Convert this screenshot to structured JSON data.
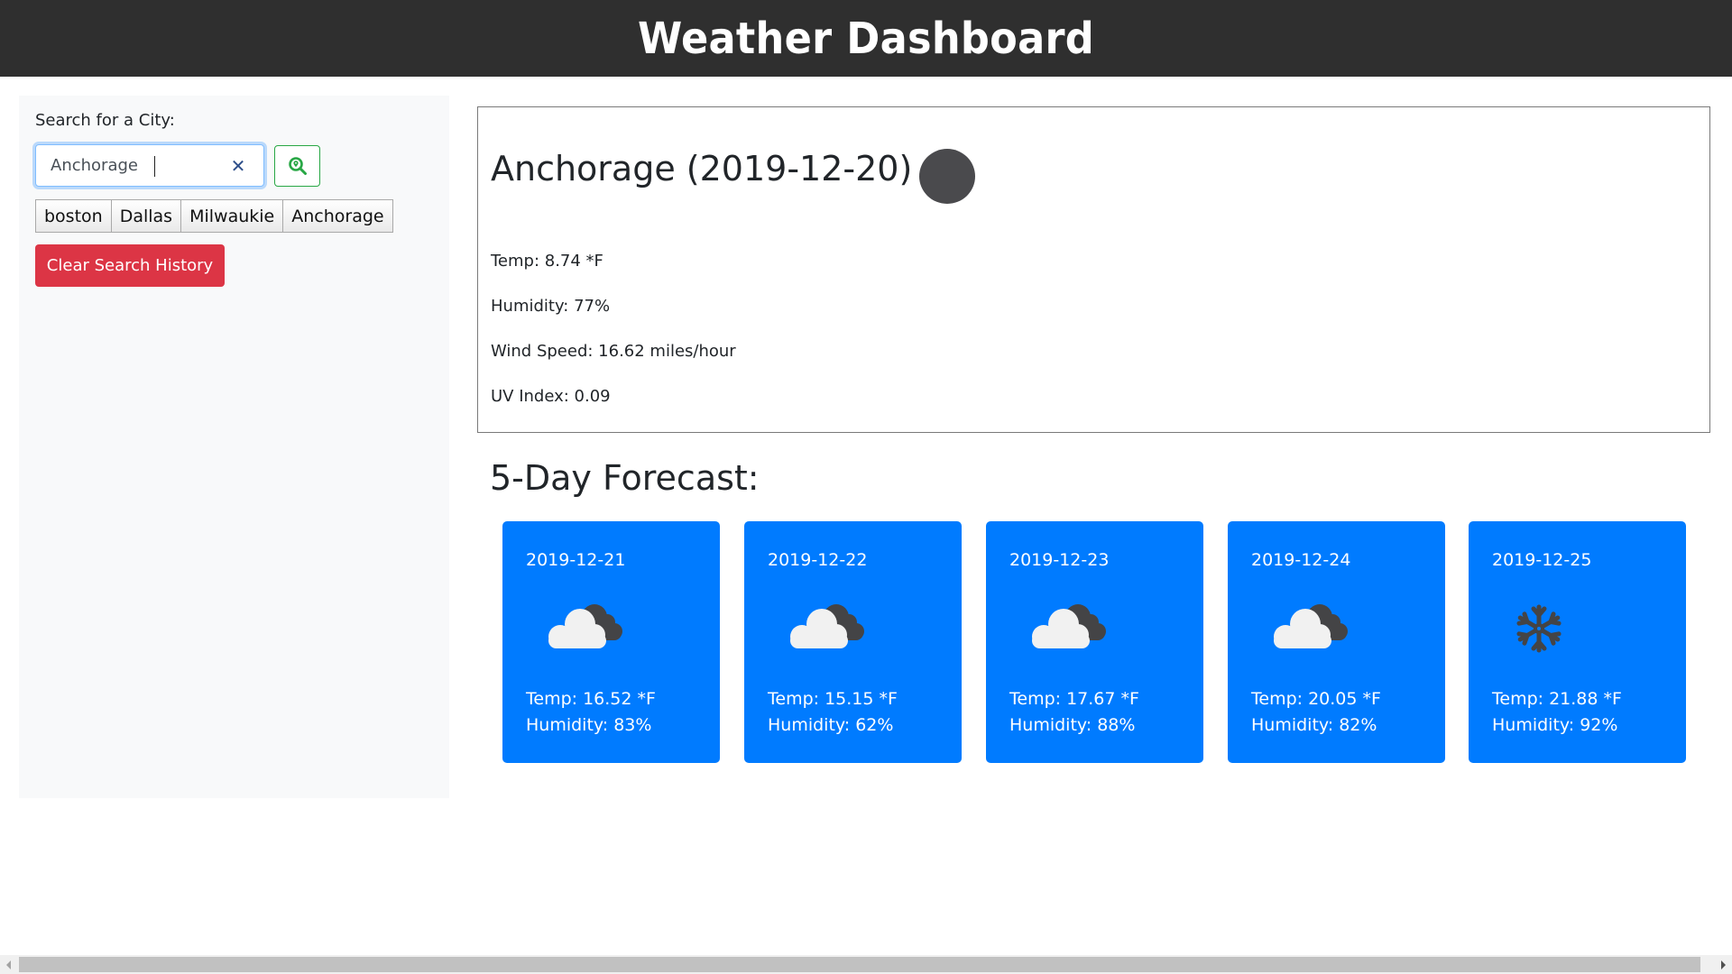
{
  "header": {
    "title": "Weather Dashboard"
  },
  "sidebar": {
    "search_label": "Search for a City:",
    "search_input": {
      "value": "Anchorage",
      "placeholder": ""
    },
    "clear_input_icon": "close-icon",
    "search_button_icon": "search-location-icon",
    "history": [
      "boston",
      "Dallas",
      "Milwaukie",
      "Anchorage"
    ],
    "clear_history_label": "Clear Search History"
  },
  "current": {
    "title": "Anchorage (2019-12-20)",
    "icon": "weather-icon-placeholder",
    "temp": "Temp: 8.74 *F",
    "humidity": "Humidity: 77%",
    "wind": "Wind Speed: 16.62 miles/hour",
    "uv": "UV Index: 0.09"
  },
  "forecast": {
    "title": "5-Day Forecast:",
    "days": [
      {
        "date": "2019-12-21",
        "icon": "cloudy-icon",
        "temp": "Temp: 16.52 *F",
        "humidity": "Humidity: 83%"
      },
      {
        "date": "2019-12-22",
        "icon": "cloudy-icon",
        "temp": "Temp: 15.15 *F",
        "humidity": "Humidity: 62%"
      },
      {
        "date": "2019-12-23",
        "icon": "cloudy-icon",
        "temp": "Temp: 17.67 *F",
        "humidity": "Humidity: 88%"
      },
      {
        "date": "2019-12-24",
        "icon": "cloudy-icon",
        "temp": "Temp: 20.05 *F",
        "humidity": "Humidity: 82%"
      },
      {
        "date": "2019-12-25",
        "icon": "snowflake-icon",
        "temp": "Temp: 21.88 *F",
        "humidity": "Humidity: 92%"
      }
    ]
  },
  "colors": {
    "header_bg": "#2f2f2f",
    "card_bg": "#007bff",
    "danger": "#dc3545",
    "success": "#28a745"
  }
}
